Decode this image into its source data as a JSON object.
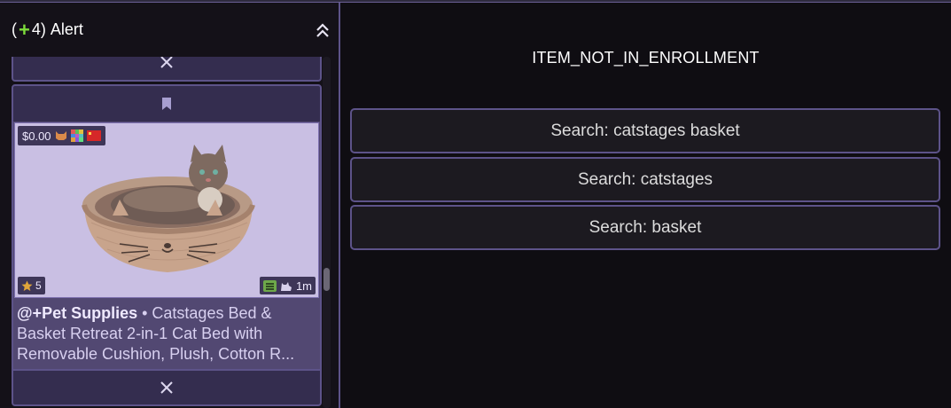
{
  "alert": {
    "prefix": "(",
    "count": "4)",
    "label": "Alert"
  },
  "card": {
    "price": "$0.00",
    "rating": "5",
    "age": "1m",
    "category": "@+Pet Supplies",
    "separator": " • ",
    "title": "Catstages Bed & Basket Retreat 2-in-1 Cat Bed with Removable Cushion, Plush, Cotton R..."
  },
  "right": {
    "status": "ITEM_NOT_IN_ENROLLMENT",
    "searches": [
      "Search: catstages basket",
      "Search: catstages",
      "Search: basket"
    ]
  },
  "colors": {
    "accent": "#5d5389",
    "plus": "#7ddc3b"
  }
}
